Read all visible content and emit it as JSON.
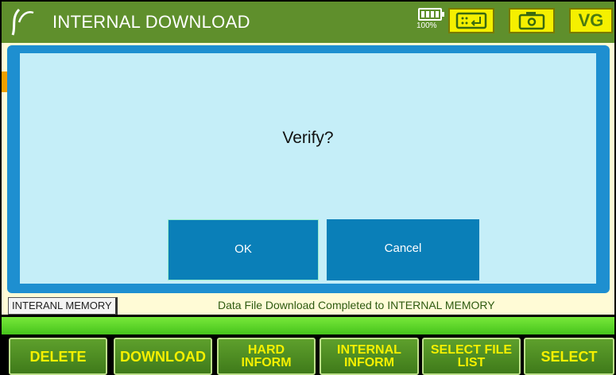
{
  "window": {
    "title": "INTERNAL DOWNLOAD"
  },
  "header": {
    "battery_percent": "100%",
    "vg_label": "VG",
    "icons": [
      "logo-icon",
      "battery-icon",
      "keyboard-icon",
      "camera-icon"
    ]
  },
  "dialog": {
    "message": "Verify?",
    "ok_label": "OK",
    "cancel_label": "Cancel"
  },
  "status": {
    "memory_label": "INTERANL MEMORY",
    "message": "Data File Download Completed to INTERNAL MEMORY",
    "progress": 1.0
  },
  "softkeys": [
    {
      "label": "DELETE"
    },
    {
      "label": "DOWNLOAD"
    },
    {
      "label": "HARD\nINFORM"
    },
    {
      "label": "INTERNAL\nINFORM"
    },
    {
      "label": "SELECT FILE\nLIST"
    },
    {
      "label": "SELECT"
    }
  ],
  "colors": {
    "titlebar": "#5f8f2c",
    "dialog_frame": "#1e8fd0",
    "dialog_body": "#c5eef8",
    "dialog_button": "#0a7fb8",
    "softkey_text": "#f5f000",
    "progress": "#46c41c"
  }
}
